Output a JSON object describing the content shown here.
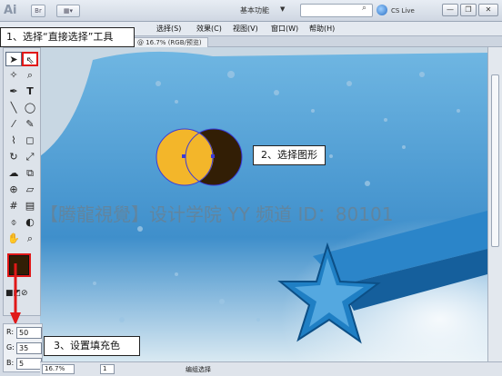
{
  "app": {
    "logo": "Ai",
    "br_button": "Br",
    "workspace": "基本功能",
    "cs_live": "CS Live",
    "window_buttons": [
      "—",
      "❐",
      "✕"
    ]
  },
  "menubar": {
    "items": [
      "选择(S)",
      "效果(C)",
      "视图(V)",
      "窗口(W)",
      "帮助(H)"
    ]
  },
  "document": {
    "tab_label": "@ 16.7% (RGB/预览)"
  },
  "callouts": {
    "step1": "1、选择“直接选择”工具",
    "step2": "2、选择图形",
    "step3": "3、设置填充色"
  },
  "color": {
    "fill_hex": "#321e05",
    "r_label": "R:",
    "g_label": "G:",
    "b_label": "B:",
    "r_value": "50",
    "g_value": "35",
    "b_value": "5"
  },
  "watermark": "【腾龍視覺】设计学院 YY 频道 ID：80101",
  "statusbar": {
    "zoom": "16.7%",
    "page": "1",
    "status_text": "编组选择"
  },
  "colors": {
    "sky_top": "#5aa6d8",
    "sky_bottom": "#1e6fb0",
    "circle_yellow": "#f3b62a",
    "circle_dark": "#321e05",
    "star_blue": "#1f7fc4",
    "highlight_red": "#e01818"
  },
  "tools": [
    "selection-tool",
    "direct-selection-tool",
    "magic-wand-tool",
    "lasso-tool",
    "pen-tool",
    "type-tool",
    "line-tool",
    "ellipse-tool",
    "paintbrush-tool",
    "pencil-tool",
    "blob-brush-tool",
    "eraser-tool",
    "rotate-tool",
    "scale-tool",
    "warp-tool",
    "free-transform-tool",
    "shape-builder-tool",
    "perspective-tool",
    "mesh-tool",
    "gradient-tool",
    "eyedropper-tool",
    "blend-tool",
    "symbol-sprayer-tool",
    "column-graph-tool",
    "artboard-tool",
    "slice-tool",
    "hand-tool",
    "zoom-tool"
  ]
}
